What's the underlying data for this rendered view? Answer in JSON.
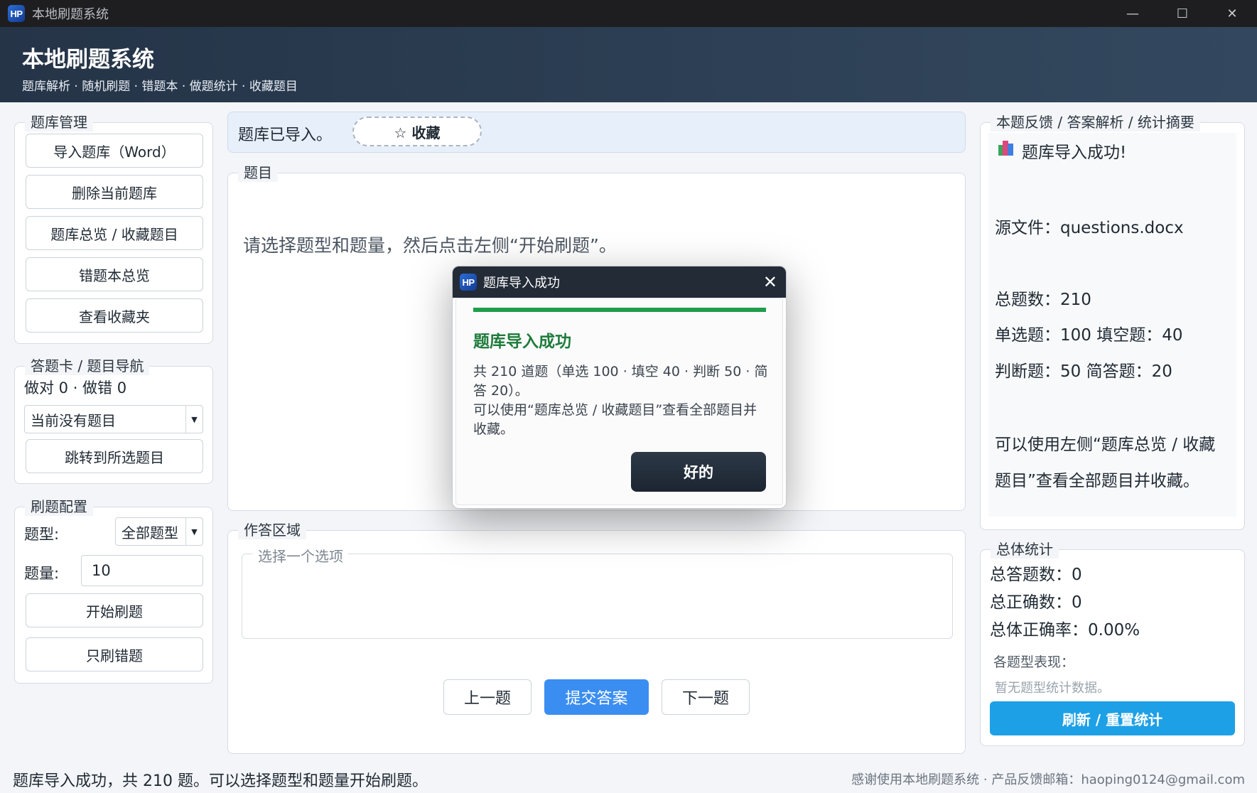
{
  "window": {
    "title": "本地刷题系统",
    "logo_text": "HP",
    "controls": {
      "minimize": "—",
      "maximize": "☐",
      "close": "✕"
    }
  },
  "header": {
    "title": "本地刷题系统",
    "subtitle": "题库解析 · 随机刷题 · 错题本 · 做题统计 · 收藏题目"
  },
  "bank_management": {
    "title": "题库管理",
    "buttons": [
      "导入题库（Word）",
      "删除当前题库",
      "题库总览 / 收藏题目",
      "错题本总览",
      "查看收藏夹"
    ]
  },
  "answer_card": {
    "title": "答题卡 / 题目导航",
    "score_text": "做对 0 · 做错 0",
    "select_value": "当前没有题目",
    "jump_button": "跳转到所选题目"
  },
  "practice_config": {
    "title": "刷题配置",
    "type_label": "题型:",
    "type_value": "全部题型",
    "count_label": "题量:",
    "count_value": "10",
    "start_button": "开始刷题",
    "wrong_only_button": "只刷错题"
  },
  "status_banner": {
    "text": "题库已导入。",
    "favorite_button": "☆ 收藏"
  },
  "question": {
    "title": "题目",
    "prompt": "请选择题型和题量，然后点击左侧“开始刷题”。"
  },
  "answer_area": {
    "title": "作答区域",
    "options_title": "选择一个选项",
    "prev_button": "上一题",
    "submit_button": "提交答案",
    "next_button": "下一题"
  },
  "feedback": {
    "title": "本题反馈 / 答案解析 / 统计摘要",
    "success_line": "题库导入成功!",
    "source_file": "源文件：questions.docx",
    "total": "总题数：210",
    "single_fill": "单选题：100 填空题：40",
    "judge_short": "判断题：50 简答题：20",
    "hint_line1": "可以使用左侧“题库总览 / 收藏",
    "hint_line2": "题目”查看全部题目并收藏。"
  },
  "overall_stats": {
    "title": "总体统计",
    "total_answered": "总答题数：0",
    "total_correct": "总正确数：0",
    "accuracy": "总体正确率：0.00%",
    "by_type_label": "各题型表现：",
    "by_type_empty": "暂无题型统计数据。",
    "refresh_button": "刷新 / 重置统计"
  },
  "footer": {
    "status": "题库导入成功，共 210 题。可以选择题型和题量开始刷题。",
    "credits": "感谢使用本地刷题系统 · 产品反馈邮箱：haoping0124@gmail.com"
  },
  "dialog": {
    "title": "题库导入成功",
    "close": "✕",
    "heading": "题库导入成功",
    "message": "共 210 道题（单选 100 · 填空 40 · 判断 50 · 简答 20）。\n可以使用“题库总览 / 收藏题目”查看全部题目并收藏。",
    "ok_button": "好的",
    "progress": 1.0
  },
  "colors": {
    "header_bg": "#2c3e54",
    "primary_blue": "#3b8ef1",
    "refresh_blue": "#1ea0e6",
    "success_green": "#1e9d4b",
    "dark_button": "#1f2833"
  }
}
